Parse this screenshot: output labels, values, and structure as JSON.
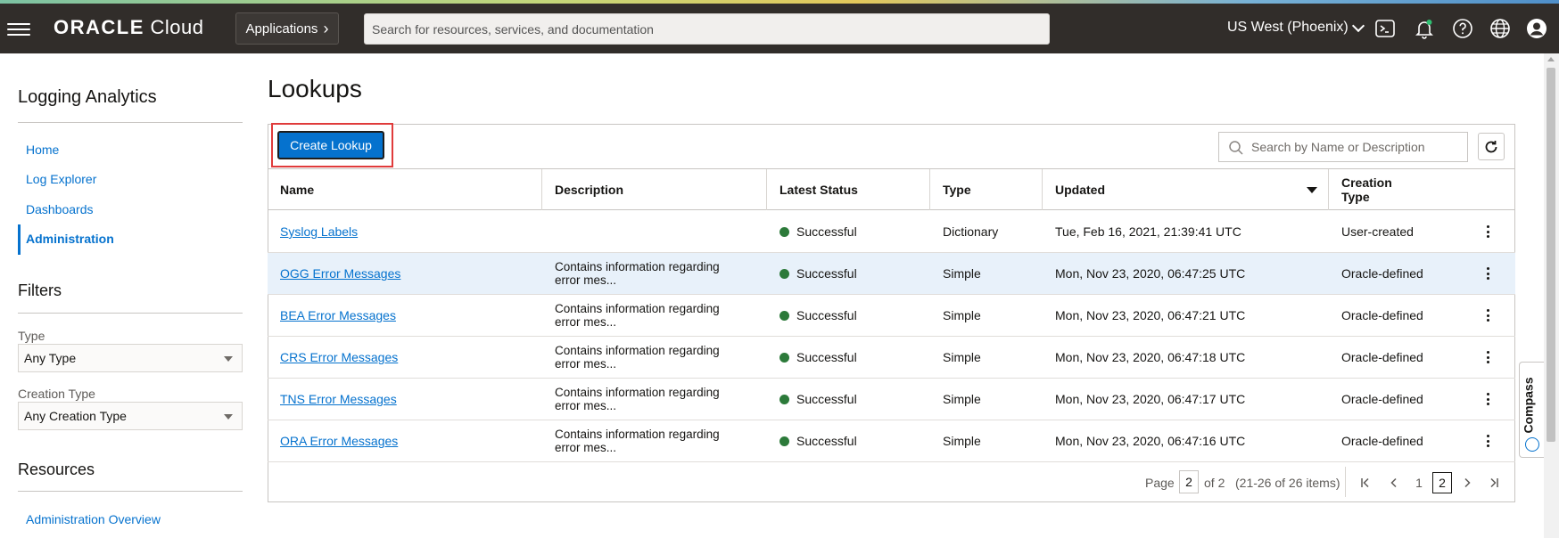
{
  "header": {
    "logo_brand": "ORACLE",
    "logo_product": "Cloud",
    "applications_label": "Applications",
    "search_placeholder": "Search for resources, services, and documentation",
    "region_label": "US West (Phoenix)",
    "icons": [
      "cloud-shell-icon",
      "bell-icon",
      "help-icon",
      "globe-icon",
      "user-icon"
    ],
    "notification_color": "#2fbf71"
  },
  "sidebar": {
    "title": "Logging Analytics",
    "nav": [
      {
        "label": "Home"
      },
      {
        "label": "Log Explorer"
      },
      {
        "label": "Dashboards"
      },
      {
        "label": "Administration",
        "active": true
      }
    ],
    "filters_title": "Filters",
    "type_label": "Type",
    "type_value": "Any Type",
    "creation_type_label": "Creation Type",
    "creation_type_value": "Any Creation Type",
    "resources_title": "Resources",
    "resources_link": "Administration Overview"
  },
  "main": {
    "title": "Lookups",
    "create_button": "Create Lookup",
    "search_placeholder": "Search by Name or Description",
    "columns": {
      "name": "Name",
      "description": "Description",
      "status": "Latest Status",
      "type": "Type",
      "updated": "Updated",
      "creation_type_1": "Creation",
      "creation_type_2": "Type"
    },
    "rows": [
      {
        "name": "Syslog Labels",
        "description_1": "",
        "description_2": "",
        "status": "Successful",
        "type": "Dictionary",
        "updated": "Tue, Feb 16, 2021, 21:39:41 UTC",
        "creation_type": "User-created"
      },
      {
        "name": "OGG Error Messages",
        "description_1": "Contains information regarding",
        "description_2": "error mes...",
        "status": "Successful",
        "type": "Simple",
        "updated": "Mon, Nov 23, 2020, 06:47:25 UTC",
        "creation_type": "Oracle-defined",
        "selected": true
      },
      {
        "name": "BEA Error Messages",
        "description_1": "Contains information regarding",
        "description_2": "error mes...",
        "status": "Successful",
        "type": "Simple",
        "updated": "Mon, Nov 23, 2020, 06:47:21 UTC",
        "creation_type": "Oracle-defined"
      },
      {
        "name": "CRS Error Messages",
        "description_1": "Contains information regarding",
        "description_2": "error mes...",
        "status": "Successful",
        "type": "Simple",
        "updated": "Mon, Nov 23, 2020, 06:47:18 UTC",
        "creation_type": "Oracle-defined"
      },
      {
        "name": "TNS Error Messages",
        "description_1": "Contains information regarding",
        "description_2": "error mes...",
        "status": "Successful",
        "type": "Simple",
        "updated": "Mon, Nov 23, 2020, 06:47:17 UTC",
        "creation_type": "Oracle-defined"
      },
      {
        "name": "ORA Error Messages",
        "description_1": "Contains information regarding",
        "description_2": "error mes...",
        "status": "Successful",
        "type": "Simple",
        "updated": "Mon, Nov 23, 2020, 06:47:16 UTC",
        "creation_type": "Oracle-defined"
      }
    ],
    "status_color": "#2c7a3a",
    "pagination": {
      "page_label": "Page",
      "current_page": "2",
      "of_label": "of 2",
      "range_label": "(21-26 of 26 items)",
      "page_1": "1",
      "page_2": "2"
    }
  },
  "compass": {
    "label": "Compass"
  },
  "colors": {
    "header_bg": "#312d2a",
    "link": "#0572ce",
    "primary_button": "#0572ce",
    "highlight_box": "#e03b3b"
  }
}
